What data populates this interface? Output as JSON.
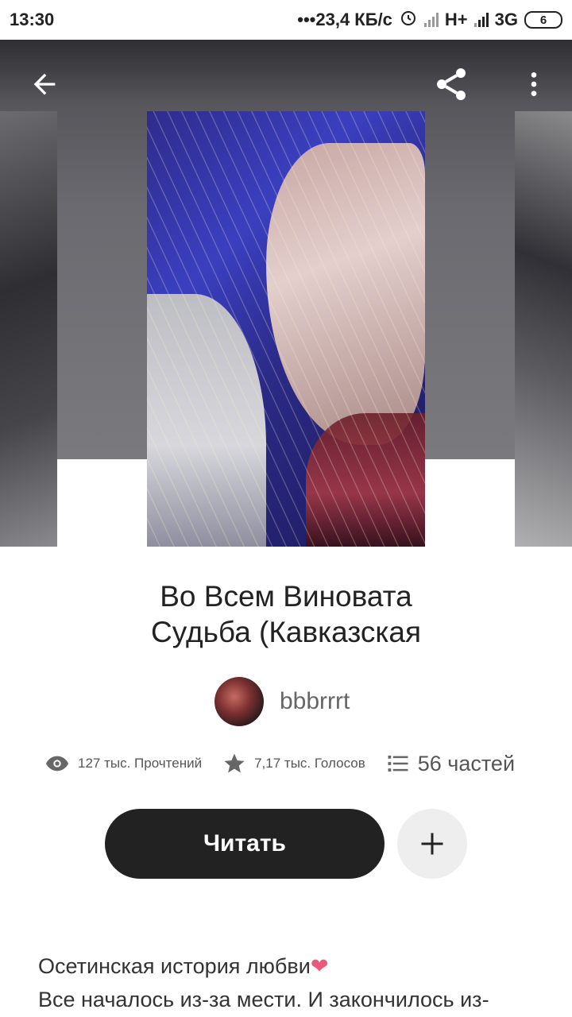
{
  "status_bar": {
    "time": "13:30",
    "speed": "•••23,4 КБ/с",
    "net1": "H+",
    "net2": "3G",
    "battery": "6"
  },
  "story": {
    "title_line1": "Во Всем Виновата",
    "title_line2": "Судьба (Кавказская",
    "author": "bbbrrrt"
  },
  "stats": {
    "reads": "127 тыс. Прочтений",
    "votes": "7,17 тыс. Голосов",
    "parts": "56 частей"
  },
  "actions": {
    "read_label": "Читать"
  },
  "description": {
    "line1": "Осетинская история любви",
    "heart": "❤",
    "line2": "Все началось из-за мести. И закончилось из-"
  },
  "icons": {
    "back": "arrow-back-icon",
    "share": "share-icon",
    "more": "more-vert-icon",
    "views": "eye-icon",
    "votes": "star-icon",
    "parts": "list-icon",
    "add": "plus-icon"
  }
}
